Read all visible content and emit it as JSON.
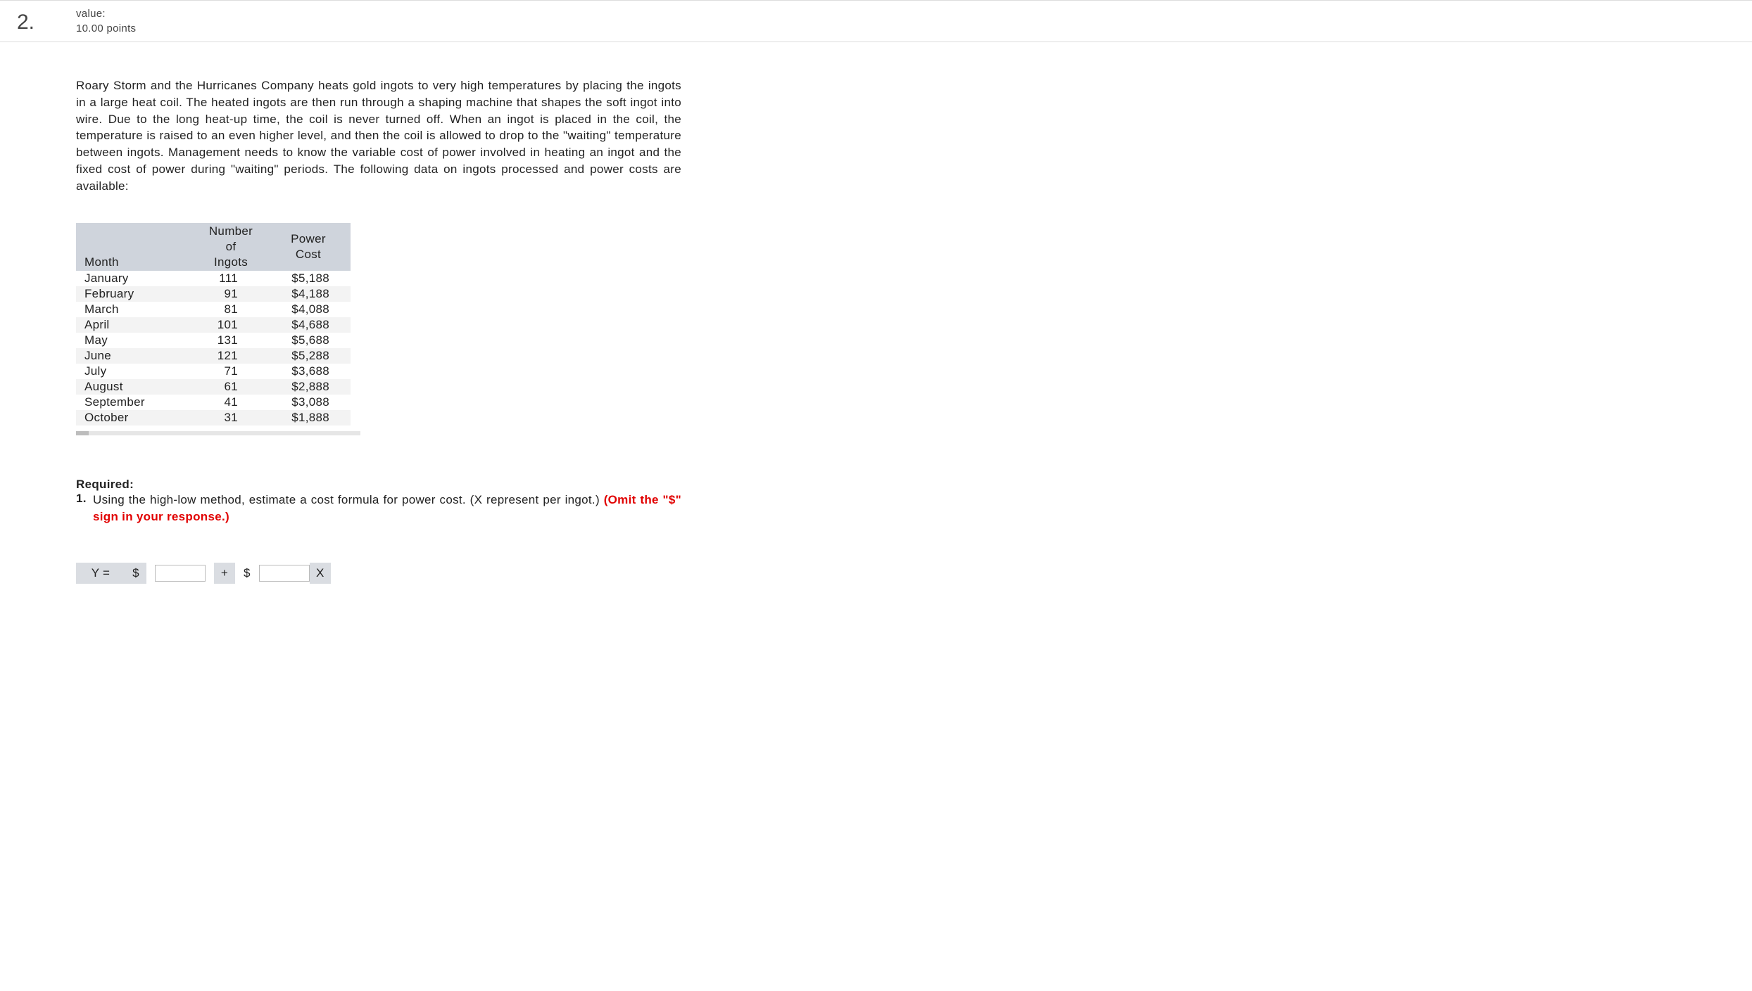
{
  "question": {
    "number": "2.",
    "value_label": "value:",
    "points": "10.00 points"
  },
  "paragraph": "Roary Storm and the Hurricanes Company heats gold ingots to very high temperatures by placing the ingots in a large heat coil. The heated ingots are then run through a shaping machine that shapes the soft ingot into wire. Due to the long heat-up time, the coil is never turned off. When an ingot is placed in the coil, the temperature is raised to an even higher level, and then the coil is allowed to drop to the \"waiting\" temperature between ingots. Management needs to know the variable cost of power involved in heating an ingot and the fixed cost of power during \"waiting\" periods. The following data on ingots processed and power costs are available:",
  "table": {
    "head": {
      "month": "Month",
      "ingots_l1": "Number of",
      "ingots_l2": "Ingots",
      "cost_l1": "Power",
      "cost_l2": "Cost"
    },
    "rows": [
      {
        "month": "January",
        "ingots": "111",
        "cost": "$5,188"
      },
      {
        "month": "February",
        "ingots": "91",
        "cost": "$4,188"
      },
      {
        "month": "March",
        "ingots": "81",
        "cost": "$4,088"
      },
      {
        "month": "April",
        "ingots": "101",
        "cost": "$4,688"
      },
      {
        "month": "May",
        "ingots": "131",
        "cost": "$5,688"
      },
      {
        "month": "June",
        "ingots": "121",
        "cost": "$5,288"
      },
      {
        "month": "July",
        "ingots": "71",
        "cost": "$3,688"
      },
      {
        "month": "August",
        "ingots": "61",
        "cost": "$2,888"
      },
      {
        "month": "September",
        "ingots": "41",
        "cost": "$3,088"
      },
      {
        "month": "October",
        "ingots": "31",
        "cost": "$1,888"
      }
    ]
  },
  "required": {
    "label": "Required:",
    "num": "1.",
    "text_main": "Using the high-low method, estimate a cost formula for power cost. (X represent per ingot.) ",
    "omit": "(Omit the \"$\" sign in your response.)"
  },
  "formula": {
    "y": "Y =",
    "dollar": "$",
    "plus": "+",
    "x": "X",
    "input1": "",
    "input2": ""
  },
  "chart_data": {
    "type": "table",
    "title": "Ingots processed and power costs",
    "columns": [
      "Month",
      "Number of Ingots",
      "Power Cost"
    ],
    "rows": [
      [
        "January",
        111,
        5188
      ],
      [
        "February",
        91,
        4188
      ],
      [
        "March",
        81,
        4088
      ],
      [
        "April",
        101,
        4688
      ],
      [
        "May",
        131,
        5688
      ],
      [
        "June",
        121,
        5288
      ],
      [
        "July",
        71,
        3688
      ],
      [
        "August",
        61,
        2888
      ],
      [
        "September",
        41,
        3088
      ],
      [
        "October",
        31,
        1888
      ]
    ]
  }
}
